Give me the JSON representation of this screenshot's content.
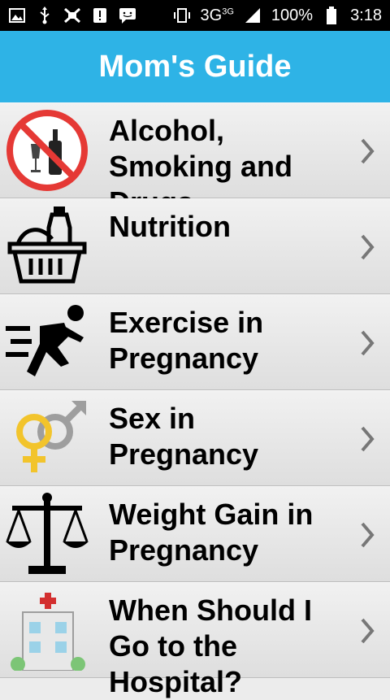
{
  "status_bar": {
    "network": "3G",
    "network_sup": "3G",
    "battery": "100%",
    "time": "3:18",
    "icons": [
      "image-icon",
      "usb-icon",
      "bug-icon",
      "alert-icon",
      "chat-icon",
      "vibrate-icon",
      "signal-icon",
      "battery-icon"
    ]
  },
  "app": {
    "title": "Mom's Guide",
    "accent": "#2eb3e6"
  },
  "items": [
    {
      "label": "Alcohol, Smoking and Drugs",
      "icon": "no-alcohol-icon"
    },
    {
      "label": "Nutrition",
      "icon": "food-basket-icon"
    },
    {
      "label": "Exercise in Pregnancy",
      "icon": "running-person-icon"
    },
    {
      "label": "Sex in Pregnancy",
      "icon": "gender-symbols-icon"
    },
    {
      "label": "Weight Gain in Pregnancy",
      "icon": "scale-icon"
    },
    {
      "label": "When Should I Go to the Hospital?",
      "icon": "hospital-icon"
    }
  ]
}
